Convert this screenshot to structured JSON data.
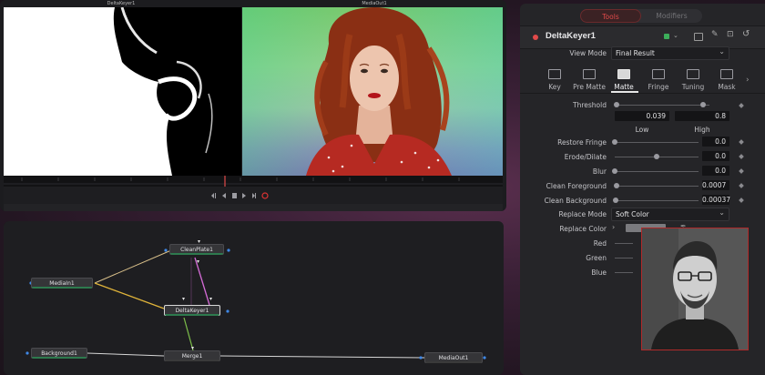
{
  "viewer": {
    "left_label": "DeltaKeyer1",
    "right_label": "MediaOut1"
  },
  "nodes": {
    "clean_plate": "CleanPlate1",
    "media_in": "MediaIn1",
    "delta_keyer": "DeltaKeyer1",
    "background": "Background1",
    "merge": "Merge1",
    "media_out": "MediaOut1"
  },
  "inspector": {
    "tabs": {
      "tools": "Tools",
      "modifiers": "Modifiers"
    },
    "tool_name": "DeltaKeyer1",
    "view_mode_label": "View Mode",
    "view_mode_value": "Final Result",
    "subtabs": [
      "Key",
      "Pre Matte",
      "Matte",
      "Fringe",
      "Tuning",
      "Mask"
    ],
    "active_subtab": "Matte",
    "threshold": {
      "label": "Threshold",
      "low_value": "0.039",
      "high_value": "0.8",
      "low_label": "Low",
      "high_label": "High"
    },
    "params": [
      {
        "label": "Restore Fringe",
        "value": "0.0",
        "level": 0.0
      },
      {
        "label": "Erode/Dilate",
        "value": "0.0",
        "level": 0.5
      },
      {
        "label": "Blur",
        "value": "0.0",
        "level": 0.0
      },
      {
        "label": "Clean Foreground",
        "value": "0.0007",
        "level": 0.02
      },
      {
        "label": "Clean Background",
        "value": "0.00037",
        "level": 0.01
      }
    ],
    "replace_mode_label": "Replace Mode",
    "replace_mode_value": "Soft Color",
    "replace_color_label": "Replace Color",
    "color_channels": [
      "Red",
      "Green",
      "Blue"
    ],
    "accent_color": "#e14a4a"
  }
}
